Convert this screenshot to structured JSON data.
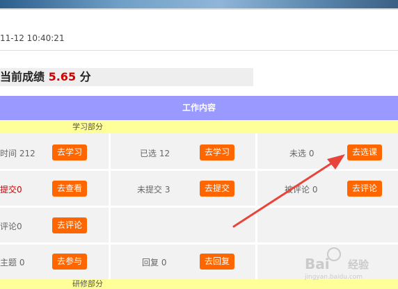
{
  "header_datetime": "11-12 10:40:21",
  "score": {
    "prefix": "当前成绩",
    "value": "5.65",
    "unit": "分"
  },
  "table": {
    "header": "工作内容",
    "sections": [
      {
        "label": "学习部分"
      },
      {
        "label": "研修部分"
      }
    ],
    "rows": [
      [
        {
          "label": "时间 212",
          "button": "去学习"
        },
        {
          "label": "已选 12",
          "button": "去学习"
        },
        {
          "label": "未选 0",
          "button": "去选课"
        }
      ],
      [
        {
          "label": "提交0",
          "button": "去查看",
          "label_color": "#cc0000"
        },
        {
          "label": "未提交 3",
          "button": "去提交"
        },
        {
          "label": "被评论 0",
          "button": "去评论"
        }
      ],
      [
        {
          "label": "评论0",
          "button": "去评论"
        }
      ],
      [
        {
          "label": "主题 0",
          "button": "去参与"
        },
        {
          "label": "回复 0",
          "button": "去回复"
        }
      ]
    ]
  },
  "colors": {
    "accent_button": "#ff6600",
    "header_bg": "#9999ff",
    "section_bg": "#ffff99",
    "score_value": "#cc0000",
    "annotation_arrow": "#e8443a"
  },
  "watermark": {
    "brand": "Bai",
    "brand_suffix": "经验",
    "url": "jingyan.baidu.com"
  }
}
